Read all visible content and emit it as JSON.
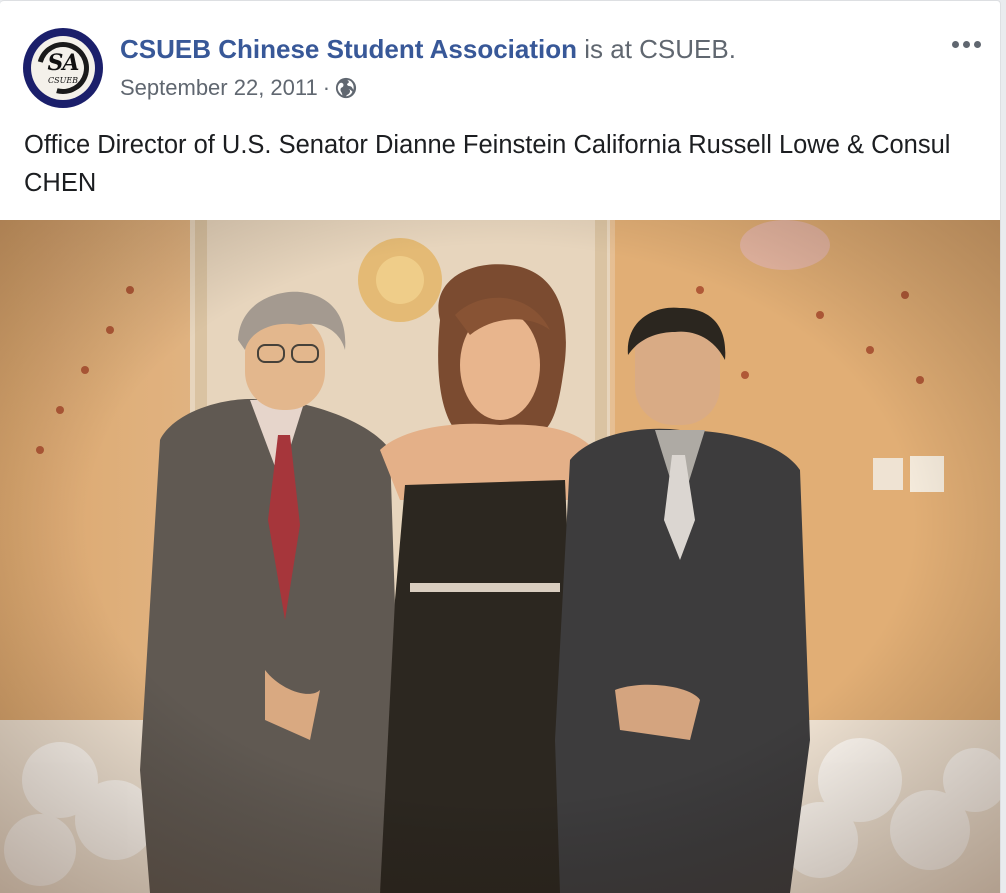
{
  "post": {
    "author": "CSUEB Chinese Student Association",
    "action_text": "is at",
    "location": "CSUEB.",
    "timestamp": "September 22, 2011",
    "separator": "·",
    "privacy_icon": "globe-icon",
    "more_icon": "more-options-icon",
    "message": "Office Director of U.S. Senator Dianne Feinstein California Russell Lowe & Consul CHEN",
    "avatar": {
      "text": "SA",
      "subtext": "CSUEB"
    }
  },
  "colors": {
    "author_link": "#385898",
    "meta_text": "#606770",
    "body_text": "#1c1e21",
    "avatar_bg": "#1b1f6b"
  }
}
